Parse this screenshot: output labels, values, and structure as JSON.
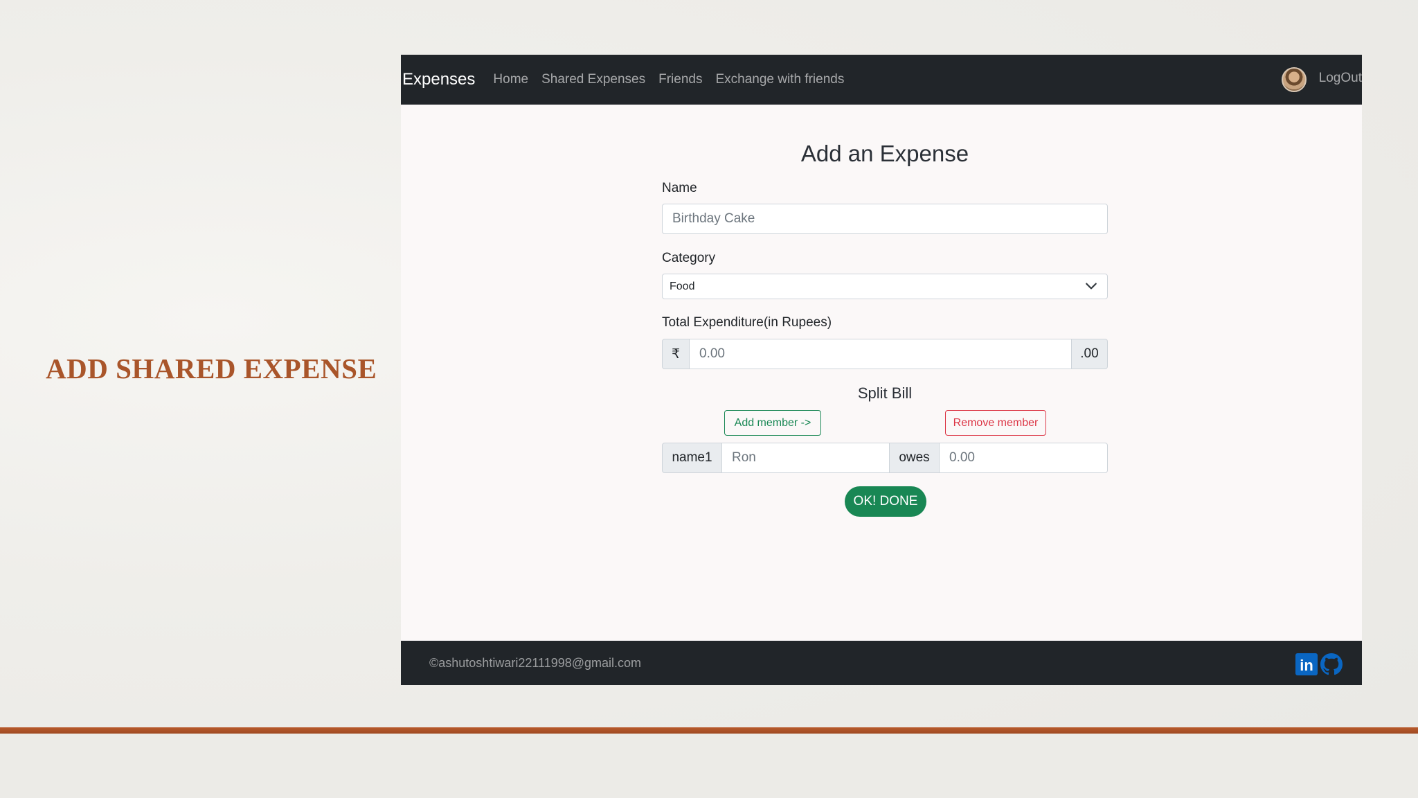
{
  "slide": {
    "title": "ADD SHARED EXPENSE",
    "accent_color": "#a9552a"
  },
  "navbar": {
    "brand": "Expenses",
    "links": [
      "Home",
      "Shared Expenses",
      "Friends",
      "Exchange with friends"
    ],
    "logout": "LogOut",
    "avatar_icon": "user-avatar"
  },
  "form": {
    "title": "Add an Expense",
    "name": {
      "label": "Name",
      "placeholder": "Birthday Cake"
    },
    "category": {
      "label": "Category",
      "selected": "Food"
    },
    "total": {
      "label": "Total Expenditure(in Rupees)",
      "prefix": "₹",
      "placeholder": "0.00",
      "suffix": ".00"
    },
    "split": {
      "title": "Split Bill",
      "add_button": "Add member ->",
      "remove_button": "Remove member",
      "member": {
        "label": "name1",
        "name_placeholder": "Ron",
        "owes_label": "owes",
        "amount_placeholder": "0.00"
      }
    },
    "submit": "OK! DONE"
  },
  "footer": {
    "text": "©ashutoshtiwari22111998@gmail.com",
    "icons": [
      "linkedin-icon",
      "github-icon"
    ]
  },
  "colors": {
    "success": "#198754",
    "danger": "#dc3545",
    "navbar_bg": "#212529",
    "linkedin": "#0a66c2"
  }
}
